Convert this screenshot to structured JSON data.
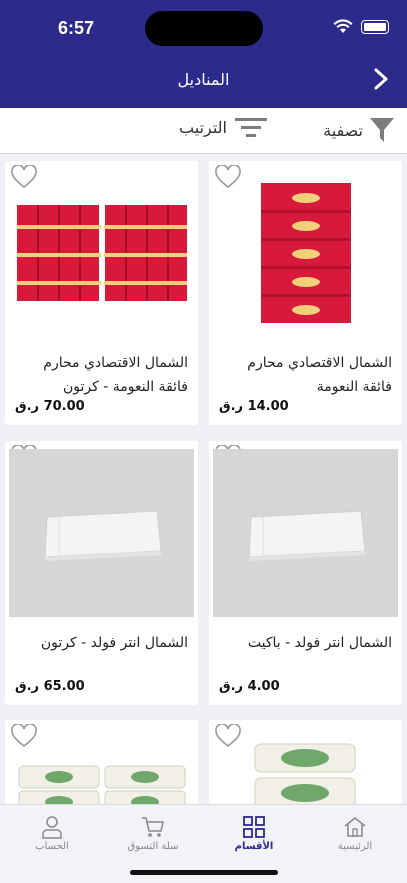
{
  "status": {
    "time": "6:57"
  },
  "header": {
    "title": "المناديل"
  },
  "toolbar": {
    "filter_label": "تصفية",
    "sort_label": "الترتيب"
  },
  "products": [
    {
      "name": "الشمال الاقتصادي محارم فائقة النعومة",
      "price": "14.00 ر.ق",
      "image": "red-tissue-pack-icon"
    },
    {
      "name": "الشمال الاقتصادي محارم فائقة النعومة - كرتون",
      "price": "70.00 ر.ق",
      "image": "red-tissue-carton-icon"
    },
    {
      "name": "الشمال انتر فولد - باكيت",
      "price": "4.00 ر.ق",
      "image": "white-paper-towel-icon"
    },
    {
      "name": "الشمال انتر فولد - كرتون",
      "price": "65.00 ر.ق",
      "image": "white-paper-towel-icon"
    },
    {
      "name": "",
      "price": "",
      "image": "tissue-packs-icon"
    },
    {
      "name": "",
      "price": "",
      "image": "tissue-packs-carton-icon"
    }
  ],
  "tabs": [
    {
      "label": "الرئيسية",
      "icon": "home-icon"
    },
    {
      "label": "الأقسام",
      "icon": "grid-icon",
      "active": true
    },
    {
      "label": "سلة التسوق",
      "icon": "cart-icon"
    },
    {
      "label": "الحساب",
      "icon": "person-icon"
    }
  ],
  "colors": {
    "primary": "#2c2a8a",
    "background": "#eef0f5",
    "product_red": "#d7193c"
  }
}
